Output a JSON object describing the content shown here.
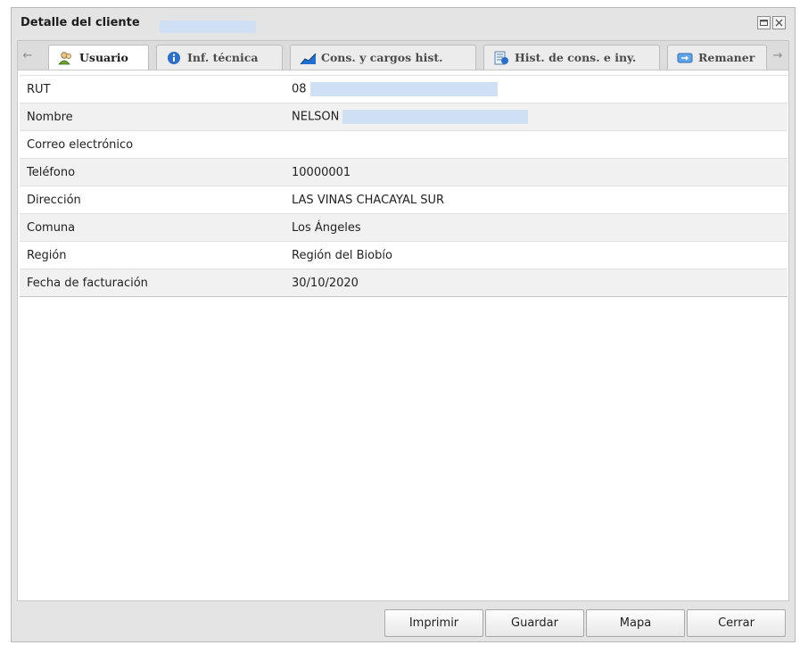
{
  "window": {
    "title": "Detalle del cliente",
    "controls": [
      "maximize-icon",
      "close-icon"
    ]
  },
  "tabs": [
    {
      "label": "Usuario",
      "icon": "users-icon",
      "active": true
    },
    {
      "label": "Inf. técnica",
      "icon": "info-icon",
      "active": false
    },
    {
      "label": "Cons. y cargos hist.",
      "icon": "chart-icon",
      "active": false
    },
    {
      "label": "Hist. de cons. e iny.",
      "icon": "document-icon",
      "active": false
    },
    {
      "label": "Remaner",
      "icon": "transfer-icon",
      "active": false
    }
  ],
  "fields": [
    {
      "label": "RUT",
      "value": "08"
    },
    {
      "label": "Nombre",
      "value": "NELSON"
    },
    {
      "label": "Correo electrónico",
      "value": ""
    },
    {
      "label": "Teléfono",
      "value": "10000001"
    },
    {
      "label": "Dirección",
      "value": "LAS VINAS CHACAYAL SUR"
    },
    {
      "label": "Comuna",
      "value": "Los Ángeles"
    },
    {
      "label": "Región",
      "value": "Región del Biobío"
    },
    {
      "label": "Fecha de facturación",
      "value": "30/10/2020"
    }
  ],
  "buttons": {
    "print": "Imprimir",
    "save": "Guardar",
    "map": "Mapa",
    "close": "Cerrar"
  },
  "colors": {
    "redaction": "#cfdff4",
    "info_blue": "#2a6fc9",
    "chart_blue": "#1f6fd0",
    "users_green": "#6aa233"
  }
}
